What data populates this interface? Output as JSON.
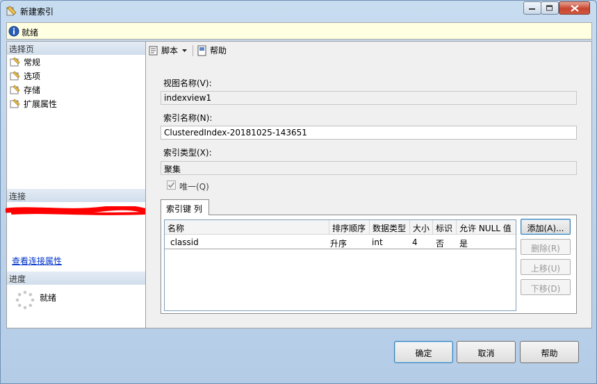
{
  "window": {
    "title": "新建索引"
  },
  "status": {
    "text": "就绪"
  },
  "sidebar": {
    "select_page_header": "选择页",
    "pages": [
      {
        "label": "常规"
      },
      {
        "label": "选项"
      },
      {
        "label": "存储"
      },
      {
        "label": "扩展属性"
      }
    ],
    "connection_header": "连接",
    "connection_link": "查看连接属性",
    "progress_header": "进度",
    "progress_text": "就绪"
  },
  "toolbar": {
    "script_label": "脚本",
    "help_label": "帮助"
  },
  "form": {
    "view_name_label": "视图名称(V):",
    "view_name_value": "indexview1",
    "index_name_label": "索引名称(N):",
    "index_name_value": "ClusteredIndex-20181025-143651",
    "index_type_label": "索引类型(X):",
    "index_type_value": "聚集",
    "unique_label": "唯一(Q)",
    "unique_checked": true
  },
  "index_keys": {
    "tab_label": "索引键 列",
    "columns": [
      "名称",
      "排序顺序",
      "数据类型",
      "大小",
      "标识",
      "允许 NULL 值"
    ],
    "rows": [
      [
        "classid",
        "升序",
        "int",
        "4",
        "否",
        "是"
      ]
    ],
    "buttons": {
      "add": "添加(A)...",
      "remove": "删除(R)",
      "move_up": "上移(U)",
      "move_down": "下移(D)"
    }
  },
  "dialog_buttons": {
    "ok": "确定",
    "cancel": "取消",
    "help": "帮助"
  },
  "colors": {
    "status_bg": "#ffffe1",
    "link": "#0033cc",
    "redaction": "#ff0000"
  }
}
